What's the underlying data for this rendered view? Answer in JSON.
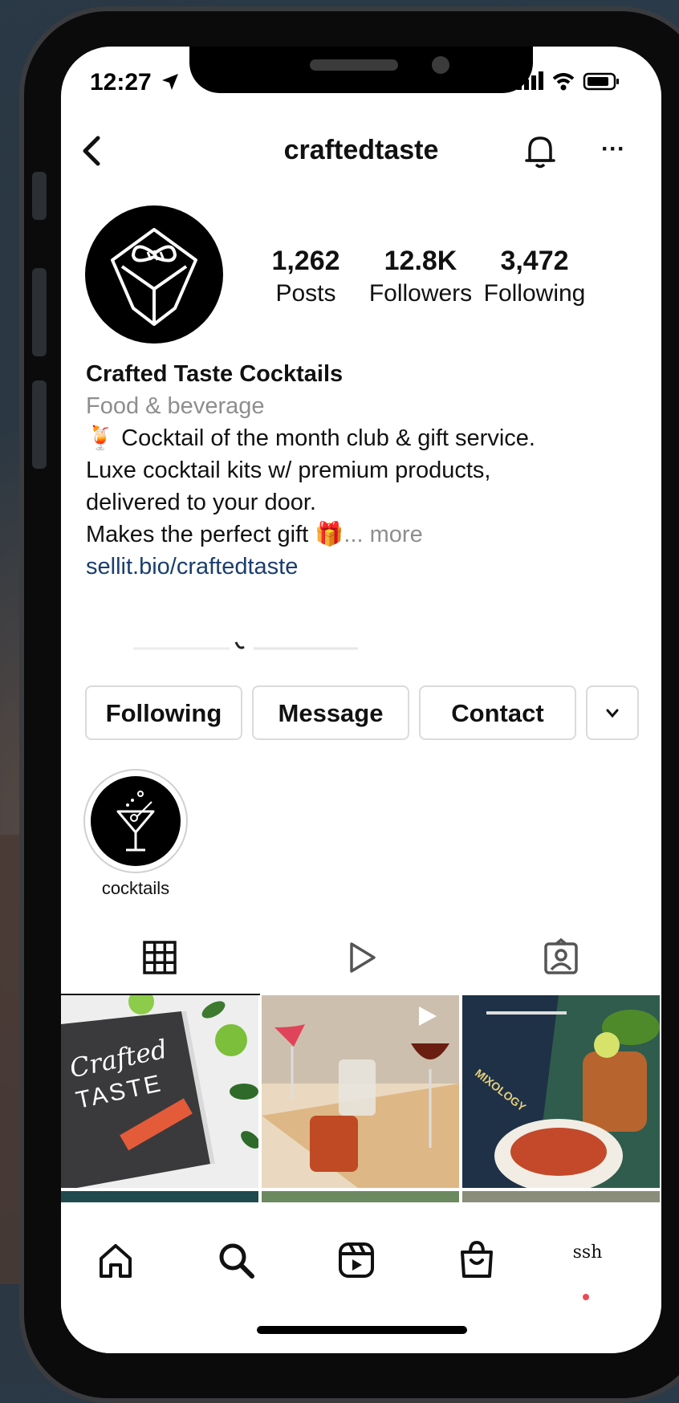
{
  "status_bar": {
    "time": "12:27"
  },
  "header": {
    "username": "craftedtaste"
  },
  "stats": [
    {
      "value": "1,262",
      "label": "Posts"
    },
    {
      "value": "12.8K",
      "label": "Followers"
    },
    {
      "value": "3,472",
      "label": "Following"
    }
  ],
  "bio": {
    "name": "Crafted Taste Cocktails",
    "category": "Food & beverage",
    "line1": "🍹 Cocktail of the month club & gift service.",
    "line2": "Luxe cocktail kits w/ premium products,",
    "line3": "delivered to your door.",
    "line4": "Makes the perfect gift 🎁",
    "more": "... more",
    "link": "sellit.bio/craftedtaste"
  },
  "actions": {
    "following": "Following",
    "message": "Message",
    "contact": "Contact"
  },
  "highlights": [
    {
      "label": "cocktails"
    }
  ],
  "grid": {
    "post1_text_top": "Crafted",
    "post1_text_bottom": "TASTE",
    "post3_book": "MIXOLOGY"
  },
  "bottom_nav": {
    "profile_label": "ssh"
  }
}
